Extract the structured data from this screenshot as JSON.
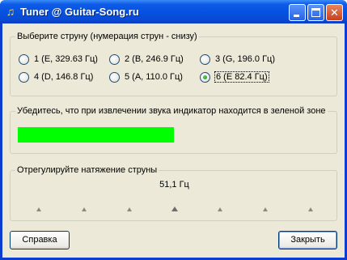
{
  "window": {
    "title": "Tuner @ Guitar-Song.ru",
    "icon": "music-note-icon"
  },
  "strings_group": {
    "legend": "Выберите струну (нумерация струн - снизу)",
    "options": [
      {
        "label": "1 (E, 329.63 Гц)",
        "checked": false
      },
      {
        "label": "2 (B, 246.9 Гц)",
        "checked": false
      },
      {
        "label": "3 (G, 196.0 Гц)",
        "checked": false
      },
      {
        "label": "4 (D, 146.8 Гц)",
        "checked": false
      },
      {
        "label": "5 (A, 110.0 Гц)",
        "checked": false
      },
      {
        "label": "6 (E 82.4 Гц)",
        "checked": true
      }
    ]
  },
  "indicator_group": {
    "legend": "Убедитесь, что при извлечении звука индикатор находится в зеленой зоне",
    "indicator_color": "#00ff00"
  },
  "tension_group": {
    "legend": "Отрегулируйте натяжение струны",
    "frequency": "51,1 Гц",
    "active_tick": 4,
    "tick_count": 7
  },
  "buttons": {
    "help_label": "Справка",
    "close_label": "Закрыть"
  }
}
